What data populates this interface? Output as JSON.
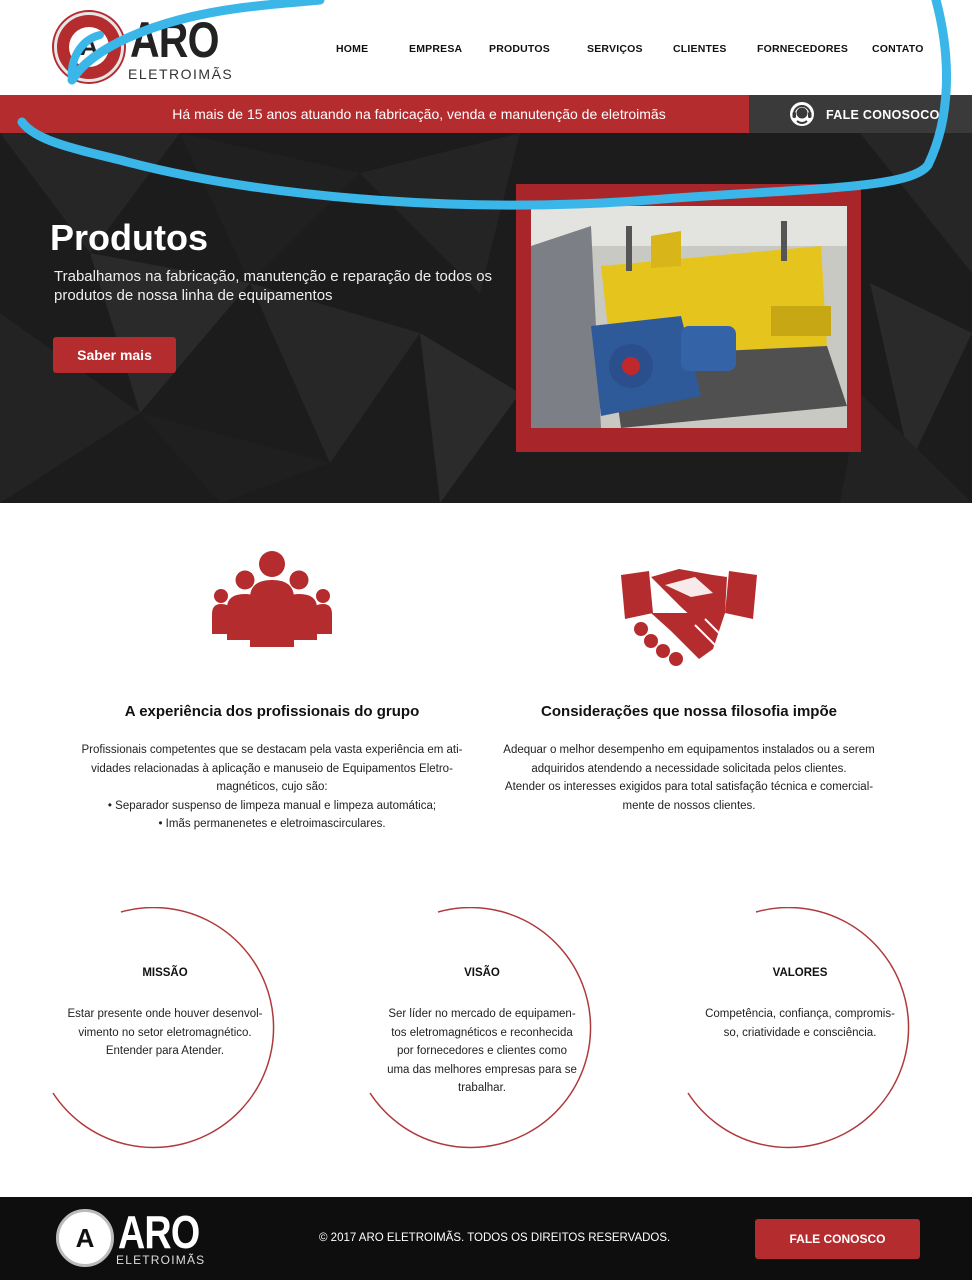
{
  "header": {
    "logo_mark": "A",
    "logo_word": "ARO",
    "logo_sub": "ELETROIMÃS",
    "nav": [
      "HOME",
      "EMPRESA",
      "PRODUTOS",
      "SERVIÇOS",
      "CLIENTES",
      "FORNECEDORES",
      "CONTATO"
    ]
  },
  "strip": {
    "tagline": "Há mais de 15 anos atuando na fabricação, venda e manutenção de eletroimãs",
    "contact_label": "FALE CONOSOCO",
    "contact_icon": "headset-icon"
  },
  "hero": {
    "title": "Produtos",
    "text": "Trabalhamos na fabricação, manutenção e reparação de todos os produtos de nossa linha de equipamentos",
    "button": "Saber mais",
    "photo": "yellow-magnetic-separator-photo"
  },
  "features": [
    {
      "icon": "group-people-icon",
      "title": "A experiência dos profissionais do grupo",
      "lines": [
        "Profissionais competentes que se destacam pela vasta experiência em ati-",
        "vidades relacionadas à aplicação e manuseio de Equipamentos Eletro-",
        "magnéticos, cujo são:",
        "• Separador suspenso de limpeza manual e limpeza automática;",
        "• Imãs permanenetes e eletroimascirculares."
      ]
    },
    {
      "icon": "handshake-icon",
      "title": "Considerações que nossa filosofia impõe",
      "lines": [
        "Adequar o melhor desempenho em equipamentos instalados ou a serem",
        "adquiridos atendendo a necessidade solicitada pelos clientes.",
        "Atender os interesses exigidos para total satisfação técnica e comercial-",
        "mente de nossos clientes."
      ]
    }
  ],
  "values": [
    {
      "title": "MISSÃO",
      "lines": [
        "Estar presente onde houver desenvol-",
        "vimento no setor eletromagnético.",
        "Entender para Atender."
      ]
    },
    {
      "title": "VISÃO",
      "lines": [
        "Ser líder no mercado de equipamen-",
        "tos eletromagnéticos e reconhecida",
        "por fornecedores e clientes como",
        "uma das melhores empresas para se",
        "trabalhar."
      ]
    },
    {
      "title": "VALORES",
      "lines": [
        "Competência, confiança, compromis-",
        "so, criatividade e consciência."
      ]
    }
  ],
  "footer": {
    "logo_mark": "A",
    "logo_word": "ARO",
    "logo_sub": "ELETROIMÃS",
    "copyright": "© 2017 ARO ELETROIMÃS. TODOS OS DIREITOS RESERVADOS.",
    "button": "FALE CONOSCO"
  },
  "colors": {
    "brand_red": "#b52c2f",
    "dark": "#1b1b1b",
    "annotation_blue": "#3ab6e8"
  }
}
